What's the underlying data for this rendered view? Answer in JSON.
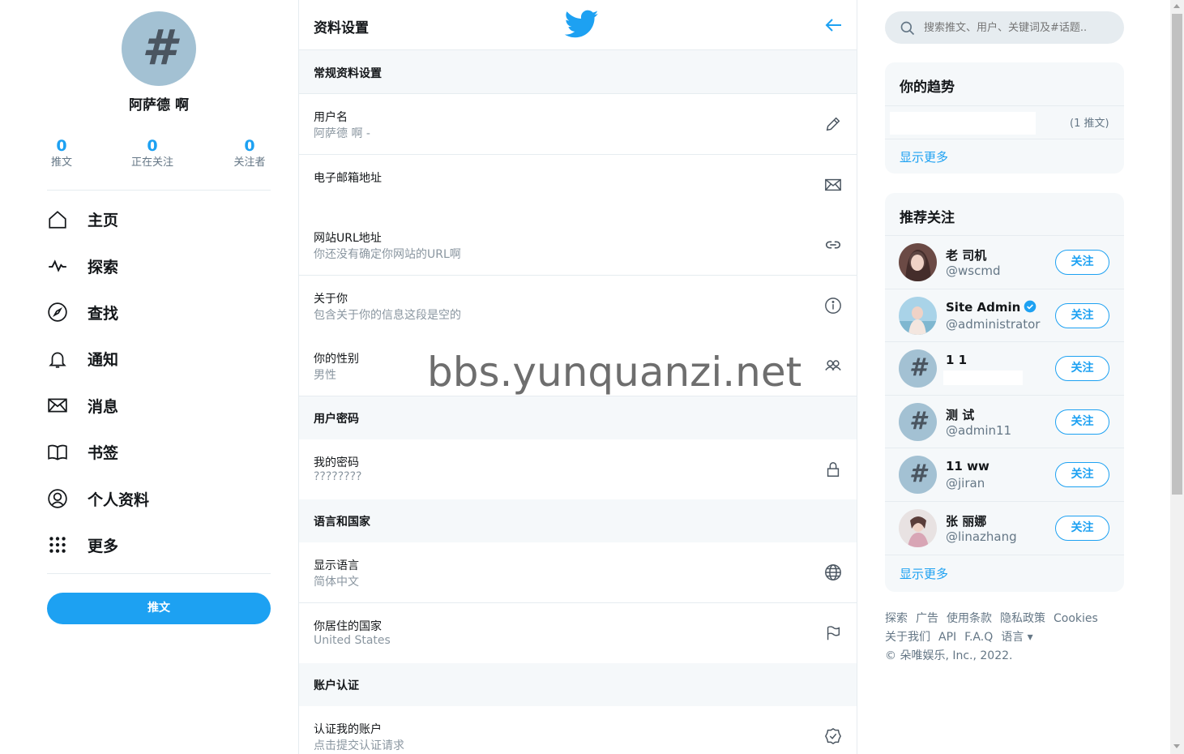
{
  "profile": {
    "avatar_glyph": "#",
    "name": "阿萨德 啊"
  },
  "stats": [
    {
      "num": "0",
      "label": "推文"
    },
    {
      "num": "0",
      "label": "正在关注"
    },
    {
      "num": "0",
      "label": "关注者"
    }
  ],
  "nav": [
    {
      "label": "主页",
      "icon": "home-icon"
    },
    {
      "label": "探索",
      "icon": "activity-icon"
    },
    {
      "label": "查找",
      "icon": "compass-icon"
    },
    {
      "label": "通知",
      "icon": "bell-icon"
    },
    {
      "label": "消息",
      "icon": "mail-icon"
    },
    {
      "label": "书签",
      "icon": "book-icon"
    },
    {
      "label": "个人资料",
      "icon": "user-circle-icon"
    },
    {
      "label": "更多",
      "icon": "grid-dots-icon"
    }
  ],
  "tweet_button": "推文",
  "header": {
    "title": "资料设置"
  },
  "sections": [
    {
      "title": "常规资料设置"
    },
    {
      "title": "用户密码"
    },
    {
      "title": "语言和国家"
    },
    {
      "title": "账户认证"
    }
  ],
  "rows": [
    {
      "label": "用户名",
      "value": "阿萨德 啊 -",
      "icon": "pencil-icon"
    },
    {
      "label": "电子邮箱地址",
      "value": "",
      "icon": "envelope-icon"
    },
    {
      "label": "网站URL地址",
      "value": "你还没有确定你网站的URL啊",
      "icon": "link-icon"
    },
    {
      "label": "关于你",
      "value": "包含关于你的信息这段是空的",
      "icon": "info-icon"
    },
    {
      "label": "你的性别",
      "value": "男性",
      "icon": "users-icon"
    },
    {
      "label": "我的密码",
      "value": "????????",
      "icon": "lock-icon"
    },
    {
      "label": "显示语言",
      "value": "简体中文",
      "icon": "globe-icon"
    },
    {
      "label": "你居住的国家",
      "value": "United States",
      "icon": "flag-icon"
    },
    {
      "label": "认证我的账户",
      "value": "点击提交认证请求",
      "icon": "verified-check-icon"
    }
  ],
  "watermark": "bbs.yunquanzi.net",
  "search": {
    "placeholder": "搜索推文、用户、关键词及#话题.."
  },
  "trends": {
    "title": "你的趋势",
    "count": "(1 推文)",
    "more": "显示更多"
  },
  "follow": {
    "title": "推荐关注",
    "button": "关注",
    "more": "显示更多",
    "users": [
      {
        "name": "老 司机",
        "handle": "@wscmd",
        "avatar": "photo"
      },
      {
        "name": "Site Admin",
        "handle": "@administrator",
        "avatar": "photo",
        "verified": true
      },
      {
        "name": "1 1",
        "handle": "",
        "avatar": "hash"
      },
      {
        "name": "测 试",
        "handle": "@admin11",
        "avatar": "hash"
      },
      {
        "name": "11 ww",
        "handle": "@jiran",
        "avatar": "hash"
      },
      {
        "name": "张 丽娜",
        "handle": "@linazhang",
        "avatar": "photo"
      }
    ]
  },
  "footer": {
    "line1": [
      "探索",
      "广告",
      "使用条款",
      "隐私政策",
      "Cookies"
    ],
    "line2": [
      "关于我们",
      "API",
      "F.A.Q",
      "语言 ▾"
    ],
    "copyright": "© 朵唯娱乐, Inc., 2022."
  },
  "colors": {
    "accent": "#1da1f2",
    "section_bg": "#f5f8fa",
    "border": "#e6ecf0",
    "muted": "#657786"
  }
}
